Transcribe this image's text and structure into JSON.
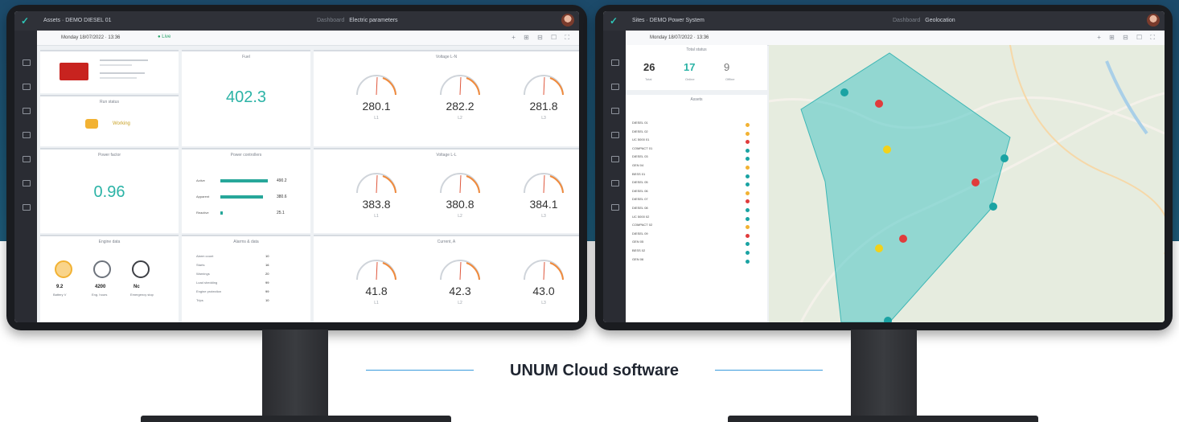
{
  "caption": "UNUM Cloud software",
  "left_app": {
    "breadcrumb": "Assets · DEMO DIESEL 01",
    "header_title_dim": "Dashboard",
    "header_title": "Electric parameters",
    "date": "Monday 18/07/2022 · 13:36",
    "live_label": "● Live",
    "status_card_title": "Run status",
    "status_value": "Working",
    "fuel_title": "Fuel",
    "fuel_value": "402.3",
    "voltage_ln_title": "Voltage L-N",
    "voltage_ln": [
      {
        "value": "280.1",
        "label": "L1"
      },
      {
        "value": "282.2",
        "label": "L2"
      },
      {
        "value": "281.8",
        "label": "L3"
      }
    ],
    "power_factor_title": "Power factor",
    "power_factor_value": "0.96",
    "power_title": "Power controllers",
    "power_rows": [
      {
        "label": "Active",
        "value": "490.2",
        "fill": 0.95
      },
      {
        "label": "Apparent",
        "value": "380.6",
        "fill": 0.85
      },
      {
        "label": "Reactive",
        "value": "25.1",
        "fill": 0.05
      }
    ],
    "voltage_ll_title": "Voltage L-L",
    "voltage_ll": [
      {
        "value": "383.8",
        "label": "L1"
      },
      {
        "value": "380.8",
        "label": "L2"
      },
      {
        "value": "384.1",
        "label": "L3"
      }
    ],
    "engine_title": "Engine data",
    "engine_stats": [
      {
        "value": "9.2",
        "label": "Battery V"
      },
      {
        "value": "4200",
        "label": "Eng. hours"
      },
      {
        "value": "Nc",
        "label": "Emergency stop"
      }
    ],
    "alarms_title": "Alarms & data",
    "alarm_rows": [
      {
        "label": "Alarm count",
        "value": "10"
      },
      {
        "label": "Starts",
        "value": "16"
      },
      {
        "label": "Warnings",
        "value": "20"
      },
      {
        "label": "Load shedding",
        "value": "99"
      },
      {
        "label": "Engine protection",
        "value": "99"
      },
      {
        "label": "Trips",
        "value": "10"
      }
    ],
    "current_title": "Current, A",
    "current": [
      {
        "value": "41.8",
        "label": "L1"
      },
      {
        "value": "42.3",
        "label": "L2"
      },
      {
        "value": "43.0",
        "label": "L3"
      }
    ]
  },
  "right_app": {
    "breadcrumb": "Sites · DEMO Power System",
    "header_title_dim": "Dashboard",
    "header_title": "Geolocation",
    "date": "Monday 18/07/2022 · 13:36",
    "stats_title": "Total status",
    "stats": [
      {
        "value": "26",
        "label": "Total",
        "color": "#333333"
      },
      {
        "value": "17",
        "label": "Online",
        "color": "#2bb3a6"
      },
      {
        "value": "9",
        "label": "Offline",
        "color": "#777777"
      }
    ],
    "list_title": "Assets",
    "assets": [
      {
        "name": "DIESEL 01",
        "status": "#f2b233"
      },
      {
        "name": "DIESEL 02",
        "status": "#f2b233"
      },
      {
        "name": "UC 5000 01",
        "status": "#e03c3c"
      },
      {
        "name": "COMPACT 01",
        "status": "#1aa3a3"
      },
      {
        "name": "DIESEL 03",
        "status": "#1aa3a3"
      },
      {
        "name": "GEN 04",
        "status": "#f2b233"
      },
      {
        "name": "BESS 01",
        "status": "#1aa3a3"
      },
      {
        "name": "DIESEL 05",
        "status": "#1aa3a3"
      },
      {
        "name": "DIESEL 06",
        "status": "#f2b233"
      },
      {
        "name": "DIESEL 07",
        "status": "#e03c3c"
      },
      {
        "name": "DIESEL 08",
        "status": "#1aa3a3"
      },
      {
        "name": "UC 5000 02",
        "status": "#1aa3a3"
      },
      {
        "name": "COMPACT 02",
        "status": "#f2b233"
      },
      {
        "name": "DIESEL 09",
        "status": "#e03c3c"
      },
      {
        "name": "GEN 05",
        "status": "#1aa3a3"
      },
      {
        "name": "BESS 02",
        "status": "#1aa3a3"
      },
      {
        "name": "GEN 06",
        "status": "#1aa3a3"
      }
    ]
  },
  "colors": {
    "accent": "#2bb3a6",
    "red": "#e03c3c",
    "yellow": "#f2d21a",
    "teal": "#1aa3a3"
  }
}
